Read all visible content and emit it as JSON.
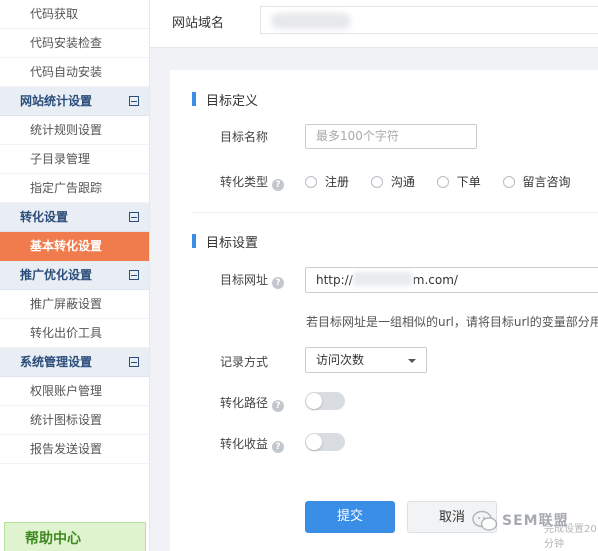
{
  "sidebar": {
    "items": [
      {
        "label": "代码获取",
        "type": "sub"
      },
      {
        "label": "代码安装检查",
        "type": "sub"
      },
      {
        "label": "代码自动安装",
        "type": "sub"
      },
      {
        "label": "网站统计设置",
        "type": "head"
      },
      {
        "label": "统计规则设置",
        "type": "sub"
      },
      {
        "label": "子目录管理",
        "type": "sub"
      },
      {
        "label": "指定广告跟踪",
        "type": "sub"
      },
      {
        "label": "转化设置",
        "type": "head"
      },
      {
        "label": "基本转化设置",
        "type": "active"
      },
      {
        "label": "推广优化设置",
        "type": "head"
      },
      {
        "label": "推广屏蔽设置",
        "type": "sub"
      },
      {
        "label": "转化出价工具",
        "type": "sub"
      },
      {
        "label": "系统管理设置",
        "type": "head"
      },
      {
        "label": "权限账户管理",
        "type": "sub"
      },
      {
        "label": "统计图标设置",
        "type": "sub"
      },
      {
        "label": "报告发送设置",
        "type": "sub"
      }
    ],
    "help_center": "帮助中心"
  },
  "topbar": {
    "site_domain_label": "网站域名"
  },
  "section_goal_definition": {
    "title": "目标定义",
    "name_label": "目标名称",
    "name_placeholder": "最多100个字符",
    "type_label": "转化类型",
    "type_options": [
      "注册",
      "沟通",
      "下单",
      "留言咨询"
    ]
  },
  "section_goal_settings": {
    "title": "目标设置",
    "url_label": "目标网址",
    "url_prefix": "http://",
    "url_suffix": "m.com/",
    "url_hint": "若目标网址是一组相似的url，请将目标url的变量部分用",
    "record_label": "记录方式",
    "record_value": "访问次数",
    "path_label": "转化路径",
    "path_enabled": false,
    "revenue_label": "转化收益",
    "revenue_enabled": false
  },
  "actions": {
    "submit": "提交",
    "cancel": "取消"
  },
  "watermark": {
    "text": "SEM联盟",
    "behind": "完成设置20分钟"
  },
  "colors": {
    "accent": "#3a8ee6",
    "active_nav": "#f07b4c",
    "nav_head_bg": "#e9eef5",
    "help_bg": "#dff3cf"
  }
}
